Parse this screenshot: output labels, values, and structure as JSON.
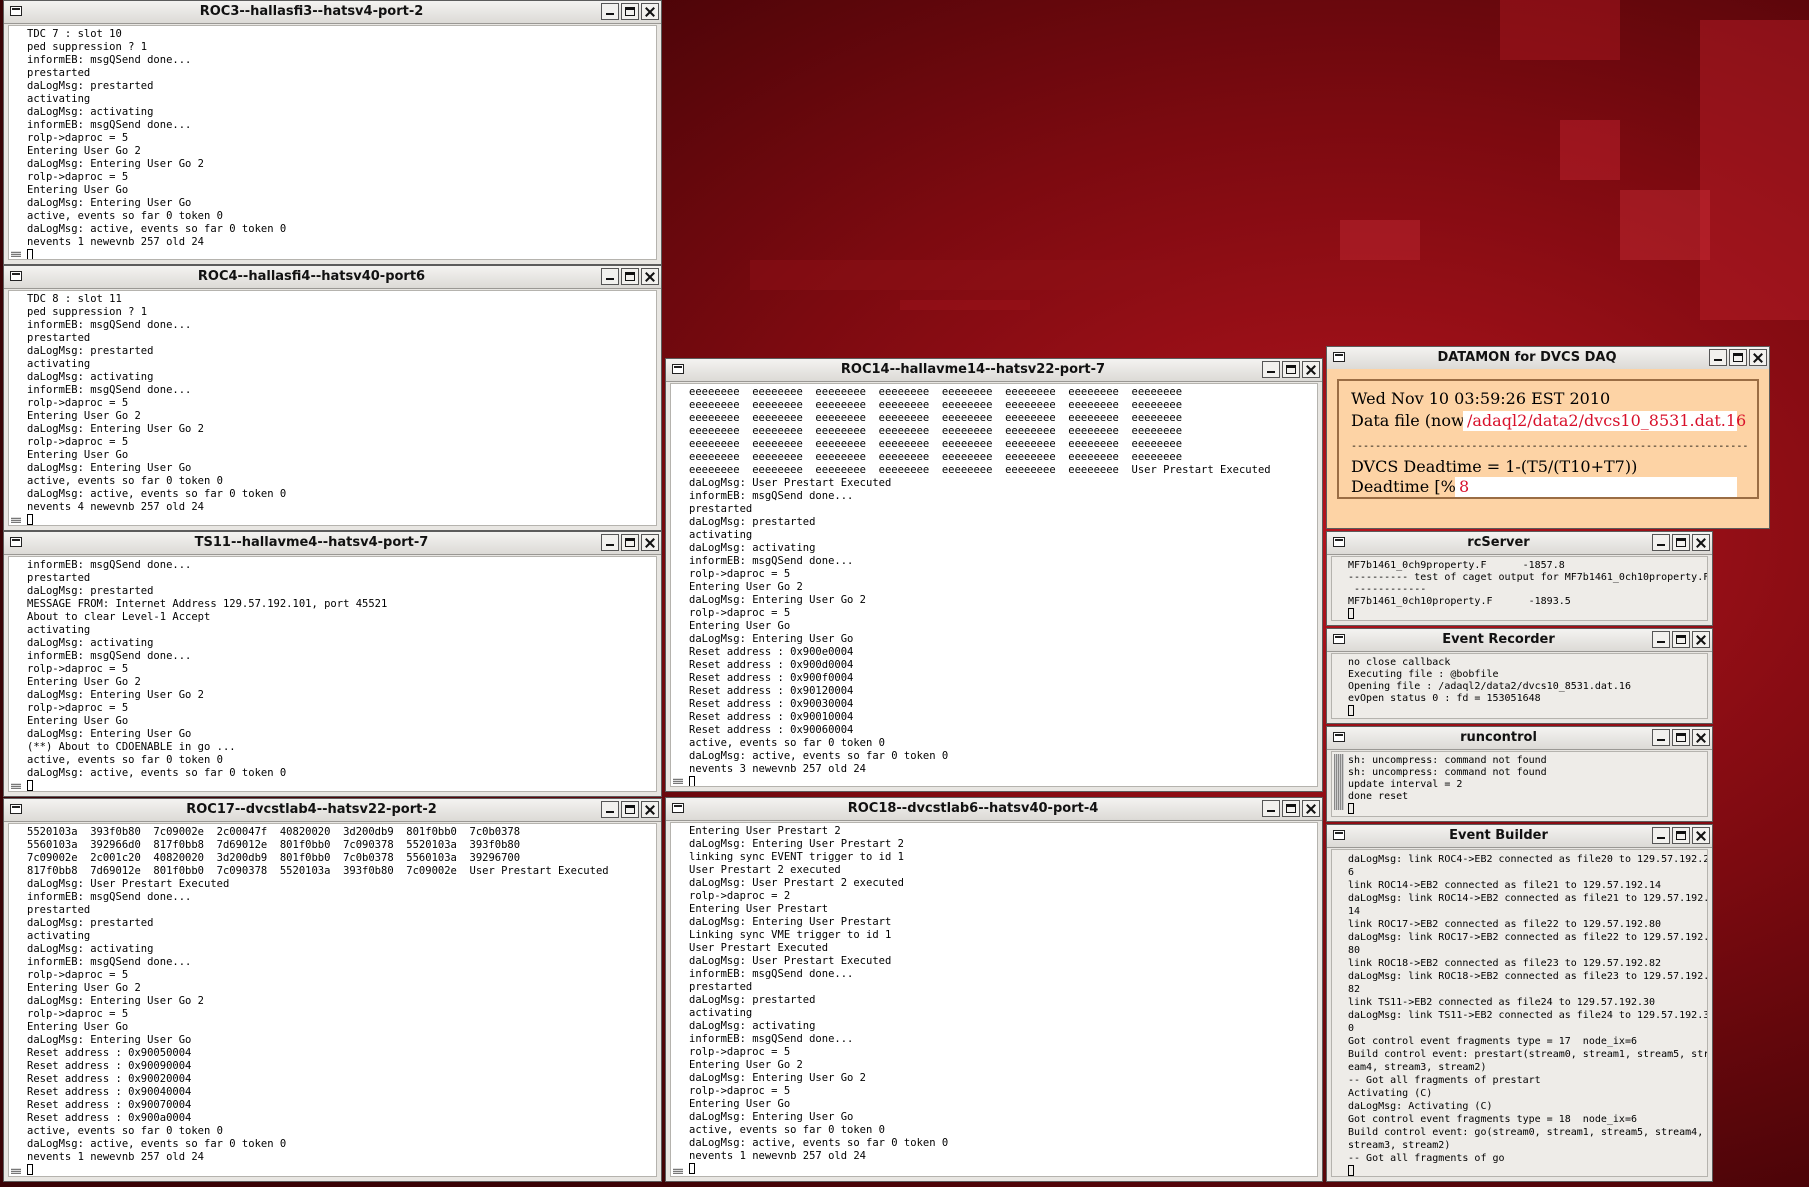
{
  "windows": {
    "roc3": {
      "title": "ROC3--hallasfi3--hatsv4-port-2",
      "text": "TDC 7 : slot 10\nped suppression ? 1\ninformEB: msgQSend done...\nprestarted\ndaLogMsg: prestarted\nactivating\ndaLogMsg: activating\ninformEB: msgQSend done...\nrolp->daproc = 5\nEntering User Go 2\ndaLogMsg: Entering User Go 2\nrolp->daproc = 5\nEntering User Go\ndaLogMsg: Entering User Go\nactive, events so far 0 token 0\ndaLogMsg: active, events so far 0 token 0\nnevents 1 newevnb 257 old 24"
    },
    "roc4": {
      "title": "ROC4--hallasfi4--hatsv40-port6",
      "text": "TDC 8 : slot 11\nped suppression ? 1\ninformEB: msgQSend done...\nprestarted\ndaLogMsg: prestarted\nactivating\ndaLogMsg: activating\ninformEB: msgQSend done...\nrolp->daproc = 5\nEntering User Go 2\ndaLogMsg: Entering User Go 2\nrolp->daproc = 5\nEntering User Go\ndaLogMsg: Entering User Go\nactive, events so far 0 token 0\ndaLogMsg: active, events so far 0 token 0\nnevents 4 newevnb 257 old 24"
    },
    "ts11": {
      "title": "TS11--hallavme4--hatsv4-port-7",
      "text": "informEB: msgQSend done...\nprestarted\ndaLogMsg: prestarted\nMESSAGE FROM: Internet Address 129.57.192.101, port 45521\nAbout to clear Level-1 Accept\nactivating\ndaLogMsg: activating\ninformEB: msgQSend done...\nrolp->daproc = 5\nEntering User Go 2\ndaLogMsg: Entering User Go 2\nrolp->daproc = 5\nEntering User Go\ndaLogMsg: Entering User Go\n(**) About to CDOENABLE in go ...\nactive, events so far 0 token 0\ndaLogMsg: active, events so far 0 token 0"
    },
    "roc17": {
      "title": "ROC17--dvcstlab4--hatsv22-port-2",
      "text": "5520103a  393f0b80  7c09002e  2c00047f  40820020  3d200db9  801f0bb0  7c0b0378\n5560103a  392966d0  817f0bb8  7d69012e  801f0bb0  7c090378  5520103a  393f0b80\n7c09002e  2c001c20  40820020  3d200db9  801f0bb0  7c0b0378  5560103a  39296700\n817f0bb8  7d69012e  801f0bb0  7c090378  5520103a  393f0b80  7c09002e  User Prestart Executed\ndaLogMsg: User Prestart Executed\ninformEB: msgQSend done...\nprestarted\ndaLogMsg: prestarted\nactivating\ndaLogMsg: activating\ninformEB: msgQSend done...\nrolp->daproc = 5\nEntering User Go 2\ndaLogMsg: Entering User Go 2\nrolp->daproc = 5\nEntering User Go\ndaLogMsg: Entering User Go\nReset address : 0x90050004\nReset address : 0x90090004\nReset address : 0x90020004\nReset address : 0x90040004\nReset address : 0x90070004\nReset address : 0x900a0004\nactive, events so far 0 token 0\ndaLogMsg: active, events so far 0 token 0\nnevents 1 newevnb 257 old 24"
    },
    "roc14": {
      "title": "ROC14--hallavme14--hatsv22-port-7",
      "text": "eeeeeeee  eeeeeeee  eeeeeeee  eeeeeeee  eeeeeeee  eeeeeeee  eeeeeeee  eeeeeeee\neeeeeeee  eeeeeeee  eeeeeeee  eeeeeeee  eeeeeeee  eeeeeeee  eeeeeeee  eeeeeeee\neeeeeeee  eeeeeeee  eeeeeeee  eeeeeeee  eeeeeeee  eeeeeeee  eeeeeeee  eeeeeeee\neeeeeeee  eeeeeeee  eeeeeeee  eeeeeeee  eeeeeeee  eeeeeeee  eeeeeeee  eeeeeeee\neeeeeeee  eeeeeeee  eeeeeeee  eeeeeeee  eeeeeeee  eeeeeeee  eeeeeeee  eeeeeeee\neeeeeeee  eeeeeeee  eeeeeeee  eeeeeeee  eeeeeeee  eeeeeeee  eeeeeeee  eeeeeeee\neeeeeeee  eeeeeeee  eeeeeeee  eeeeeeee  eeeeeeee  eeeeeeee  eeeeeeee  User Prestart Executed\ndaLogMsg: User Prestart Executed\ninformEB: msgQSend done...\nprestarted\ndaLogMsg: prestarted\nactivating\ndaLogMsg: activating\ninformEB: msgQSend done...\nrolp->daproc = 5\nEntering User Go 2\ndaLogMsg: Entering User Go 2\nrolp->daproc = 5\nEntering User Go\ndaLogMsg: Entering User Go\nReset address : 0x900e0004\nReset address : 0x900d0004\nReset address : 0x900f0004\nReset address : 0x90120004\nReset address : 0x90030004\nReset address : 0x90010004\nReset address : 0x90060004\nactive, events so far 0 token 0\ndaLogMsg: active, events so far 0 token 0\nnevents 3 newevnb 257 old 24"
    },
    "roc18": {
      "title": "ROC18--dvcstlab6--hatsv40-port-4",
      "text": "Entering User Prestart 2\ndaLogMsg: Entering User Prestart 2\nlinking sync EVENT trigger to id 1\nUser Prestart 2 executed\ndaLogMsg: User Prestart 2 executed\nrolp->daproc = 2\nEntering User Prestart\ndaLogMsg: Entering User Prestart\nLinking sync VME trigger to id 1\nUser Prestart Executed\ndaLogMsg: User Prestart Executed\ninformEB: msgQSend done...\nprestarted\ndaLogMsg: prestarted\nactivating\ndaLogMsg: activating\ninformEB: msgQSend done...\nrolp->daproc = 5\nEntering User Go 2\ndaLogMsg: Entering User Go 2\nrolp->daproc = 5\nEntering User Go\ndaLogMsg: Entering User Go\nactive, events so far 0 token 0\ndaLogMsg: active, events so far 0 token 0\nnevents 1 newevnb 257 old 24"
    },
    "datamon": {
      "title": "DATAMON  for DVCS DAQ",
      "date": "Wed Nov 10 03:59:26 EST 2010",
      "datafile_label": "Data file (now)",
      "datafile_value": "/adaql2/data2/dvcs10_8531.dat.16",
      "separator": "------------------------------------------------------------------------------------------------------------",
      "deadtime_formula": "DVCS Deadtime = 1-(T5/(T10+T7))",
      "deadtime_label": "Deadtime [%]:",
      "deadtime_value": "8"
    },
    "rcserver": {
      "title": "rcServer",
      "text": "MF7b1461_0ch9property.F      -1857.8\n---------- test of caget output for MF7b1461_0ch10property.F\n ------------\nMF7b1461_0ch10property.F      -1893.5"
    },
    "eventrecorder": {
      "title": "Event Recorder",
      "text": "no close callback\nExecuting file : @bobfile\nOpening file : /adaql2/data2/dvcs10_8531.dat.16\nevOpen status 0 : fd = 153051648"
    },
    "runcontrol": {
      "title": "runcontrol",
      "text": "sh: uncompress: command not found\nsh: uncompress: command not found\nupdate interval = 2\ndone reset"
    },
    "eventbuilder": {
      "title": "Event Builder",
      "text": "daLogMsg: link ROC4->EB2 connected as file20 to 129.57.192.2\n6\nlink ROC14->EB2 connected as file21 to 129.57.192.14\ndaLogMsg: link ROC14->EB2 connected as file21 to 129.57.192.\n14\nlink ROC17->EB2 connected as file22 to 129.57.192.80\ndaLogMsg: link ROC17->EB2 connected as file22 to 129.57.192.\n80\nlink ROC18->EB2 connected as file23 to 129.57.192.82\ndaLogMsg: link ROC18->EB2 connected as file23 to 129.57.192.\n82\nlink TS11->EB2 connected as file24 to 129.57.192.30\ndaLogMsg: link TS11->EB2 connected as file24 to 129.57.192.3\n0\nGot control event fragments type = 17  node_ix=6\nBuild control event: prestart(stream0, stream1, stream5, str\neam4, stream3, stream2)\n-- Got all fragments of prestart\nActivating (C)\ndaLogMsg: Activating (C)\nGot control event fragments type = 18  node_ix=6\nBuild control event: go(stream0, stream1, stream5, stream4,\nstream3, stream2)\n-- Got all fragments of go"
    }
  },
  "colors": {
    "desktop": "#5a0508",
    "datamon_bg": "#fdd3a5",
    "datamon_value": "#d8102a"
  }
}
